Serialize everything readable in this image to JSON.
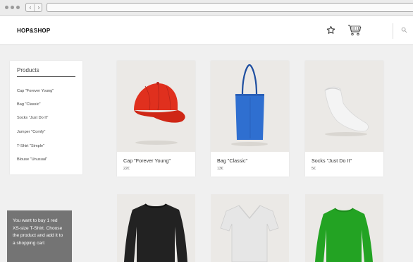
{
  "header": {
    "logo": "HOP&SHOP",
    "icons": [
      "star-icon",
      "cart-icon",
      "search-icon"
    ]
  },
  "sidebar": {
    "title": "Products",
    "items": [
      {
        "label": "Cap \"Forever Young\""
      },
      {
        "label": "Bag \"Classic\""
      },
      {
        "label": "Socks \"Just Do It\""
      },
      {
        "label": "Jumper \"Comfy\""
      },
      {
        "label": "T-Shirt \"Simple\""
      },
      {
        "label": "Blouse \"Unusual\""
      }
    ]
  },
  "products": [
    {
      "name": "Cap \"Forever Young\"",
      "price": "22€",
      "color": "#e0301e"
    },
    {
      "name": "Bag \"Classic\"",
      "price": "13€",
      "color": "#2f6fd0"
    },
    {
      "name": "Socks \"Just Do It\"",
      "price": "5€",
      "color": "#f4f4f4"
    }
  ],
  "products_row2": [
    {
      "color": "#222222"
    },
    {
      "color": "#e6e6e6"
    },
    {
      "color": "#23a323"
    }
  ],
  "task": {
    "text": "You want to buy 1 red XS-size T-Shirt. Choose the product and add it to a shopping cart"
  }
}
